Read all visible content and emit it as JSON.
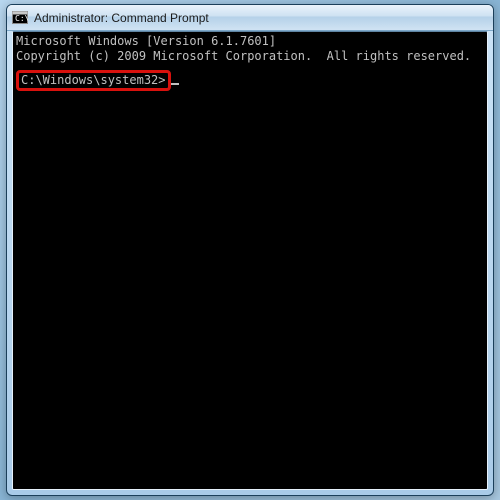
{
  "window": {
    "title": "Administrator: Command Prompt",
    "icon_name": "cmd-icon"
  },
  "terminal": {
    "line1": "Microsoft Windows [Version 6.1.7601]",
    "line2": "Copyright (c) 2009 Microsoft Corporation.  All rights reserved.",
    "blank": "",
    "prompt": "C:\\Windows\\system32>"
  },
  "colors": {
    "highlight_border": "#d8110d",
    "terminal_bg": "#000000",
    "terminal_fg": "#c0c0c0"
  }
}
